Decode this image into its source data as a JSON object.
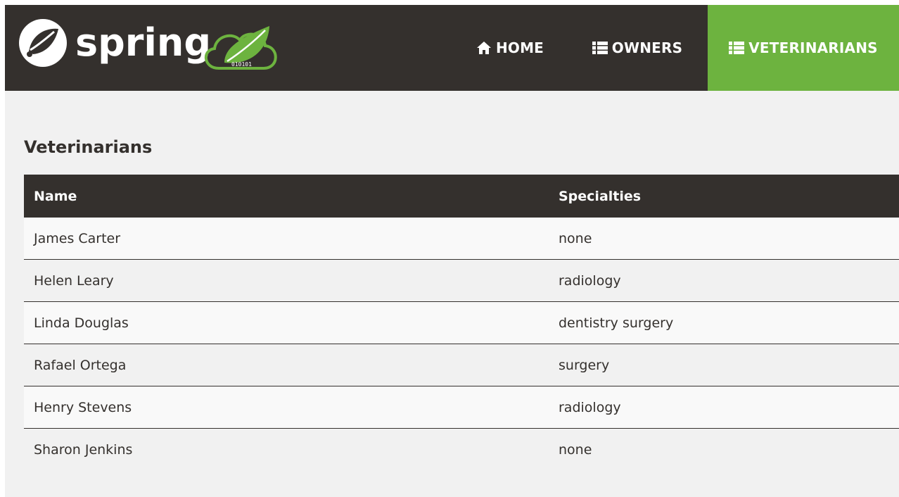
{
  "brand": {
    "name": "spring",
    "leaf_text": "010101",
    "icon": "spring-leaf-logo",
    "colors": {
      "green": "#6db33f",
      "dark": "#34302d",
      "white": "#ffffff"
    }
  },
  "nav": {
    "home": {
      "label": "HOME",
      "icon": "home-icon"
    },
    "owners": {
      "label": "OWNERS",
      "icon": "list-icon"
    },
    "veterinarians": {
      "label": "VETERINARIANS",
      "icon": "list-icon",
      "active": true
    }
  },
  "page": {
    "title": "Veterinarians"
  },
  "table": {
    "headers": [
      "Name",
      "Specialties"
    ],
    "rows": [
      {
        "name": "James Carter",
        "specialties": "none"
      },
      {
        "name": "Helen Leary",
        "specialties": "radiology"
      },
      {
        "name": "Linda Douglas",
        "specialties": "dentistry surgery"
      },
      {
        "name": "Rafael Ortega",
        "specialties": "surgery"
      },
      {
        "name": "Henry Stevens",
        "specialties": "radiology"
      },
      {
        "name": "Sharon Jenkins",
        "specialties": "none"
      }
    ]
  }
}
